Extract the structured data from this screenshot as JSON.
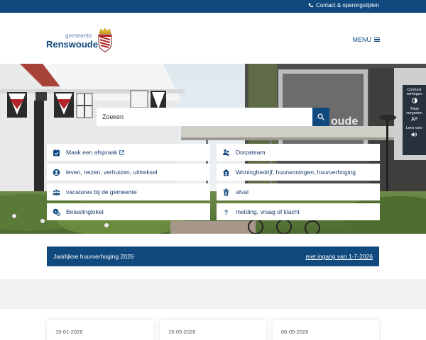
{
  "topbar": {
    "contact_label": "Contact & openingstijden"
  },
  "header": {
    "logo_small": "gemeente",
    "logo_big": "Renswoude",
    "menu_label": "MENU"
  },
  "search": {
    "placeholder": "Zoeken"
  },
  "tiles": [
    {
      "label": "Maak een afspraak",
      "icon": "calendar-check-icon"
    },
    {
      "label": "Dorpsteam",
      "icon": "team-icon"
    },
    {
      "label": "leven, reizen, verhuizen, uittreksel",
      "icon": "user-circle-icon"
    },
    {
      "label": "Woningbedrijf, huurwoningen, huurverhoging",
      "icon": "house-user-icon"
    },
    {
      "label": "vacatures bij de gemeente",
      "icon": "people-group-icon"
    },
    {
      "label": "afval",
      "icon": "trash-icon"
    },
    {
      "label": "Belastingloket",
      "icon": "tax-icon"
    },
    {
      "label": "melding, vraag of klacht",
      "icon": "question-icon"
    }
  ],
  "a11y": {
    "contrast": "Contrast verhogen",
    "text": "Tekst vergroten",
    "text_glyph": "Aᴬ",
    "read": "Lees voor"
  },
  "announcement": {
    "title": "Jaarlijkse huurverhoging 2026",
    "link": "met ingang van 1-7-2026"
  },
  "news_dates": [
    "15-01-2026",
    "15-05-2026",
    "06-05-2026"
  ],
  "colors": {
    "primary": "#10497e",
    "dark_panel": "#26313d"
  }
}
